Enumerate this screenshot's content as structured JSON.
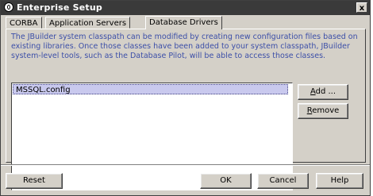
{
  "window": {
    "title": "Enterprise Setup",
    "close_glyph": "x"
  },
  "tabs": [
    {
      "label": "CORBA",
      "active": false
    },
    {
      "label": "Application Servers",
      "active": false
    },
    {
      "label": "Database Drivers",
      "active": true
    }
  ],
  "description": "The JBuilder system classpath can be modified by creating new configuration files based on existing libraries.  Once those classes have been added to your system classpath, JBuilder system-level tools, such as the Database Pilot, will be able to access those classes.",
  "drivers": {
    "items": [
      "MSSQL.config"
    ]
  },
  "side_buttons": {
    "add_prefix": "",
    "add_mnemonic": "A",
    "add_rest": "dd ...",
    "remove_prefix": "",
    "remove_mnemonic": "R",
    "remove_rest": "emove"
  },
  "footer": {
    "reset": "Reset",
    "ok": "OK",
    "cancel": "Cancel",
    "help": "Help"
  },
  "colors": {
    "description_text": "#3c4fa8",
    "selection": "#c9c9ee",
    "titlebar": "#3a3a3a"
  }
}
